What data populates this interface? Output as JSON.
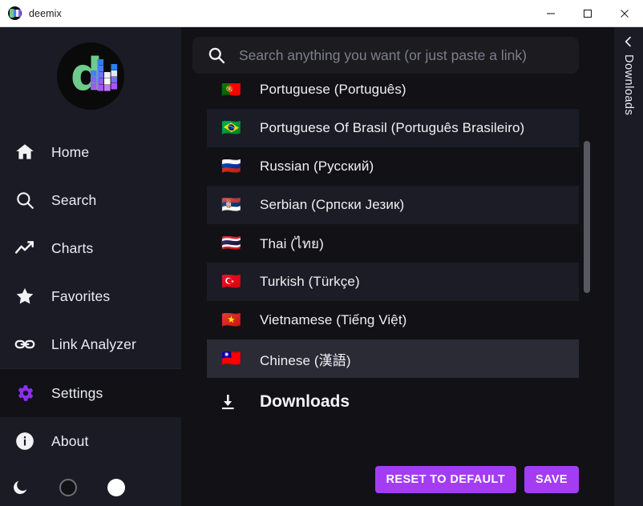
{
  "window": {
    "title": "deemix",
    "logo_icon": "deemix-logo-icon",
    "controls": {
      "minimize": "minimize-icon",
      "maximize": "maximize-icon",
      "close": "close-icon"
    }
  },
  "sidebar": {
    "logo_icon": "deemix-logo-icon",
    "items": [
      {
        "label": "Home",
        "icon": "home-icon",
        "active": false
      },
      {
        "label": "Search",
        "icon": "search-icon",
        "active": false
      },
      {
        "label": "Charts",
        "icon": "chart-line-icon",
        "active": false
      },
      {
        "label": "Favorites",
        "icon": "star-icon",
        "active": false
      },
      {
        "label": "Link Analyzer",
        "icon": "link-icon",
        "active": false
      },
      {
        "label": "Settings",
        "icon": "gear-icon",
        "active": true
      },
      {
        "label": "About",
        "icon": "info-circle-icon",
        "active": false
      }
    ],
    "themes": [
      {
        "name": "dark-theme-toggle",
        "icon": "moon-icon"
      },
      {
        "name": "black-theme-toggle",
        "icon": "dark-circle-icon"
      },
      {
        "name": "light-theme-toggle",
        "icon": "light-circle-icon"
      }
    ]
  },
  "search": {
    "placeholder": "Search anything you want (or just paste a link)",
    "value": "",
    "icon": "search-icon"
  },
  "languages": [
    {
      "name": "Portuguese (Português)",
      "flag": "🇵🇹",
      "selected": false
    },
    {
      "name": "Portuguese Of Brasil (Português Brasileiro)",
      "flag": "🇧🇷",
      "selected": false
    },
    {
      "name": "Russian (Русский)",
      "flag": "🇷🇺",
      "selected": false
    },
    {
      "name": "Serbian (Српски Језик)",
      "flag": "🇷🇸",
      "selected": false
    },
    {
      "name": "Thai (ไทย)",
      "flag": "🇹🇭",
      "selected": false
    },
    {
      "name": "Turkish (Türkçe)",
      "flag": "🇹🇷",
      "selected": false
    },
    {
      "name": "Vietnamese (Tiếng Việt)",
      "flag": "🇻🇳",
      "selected": false
    },
    {
      "name": "Chinese (漢語)",
      "flag": "🇹🇼",
      "selected": true
    }
  ],
  "downloads_section": {
    "title": "Downloads",
    "icon": "download-icon"
  },
  "footer": {
    "reset_label": "RESET TO DEFAULT",
    "save_label": "SAVE"
  },
  "downloads_panel": {
    "label": "Downloads",
    "chevron_icon": "chevron-left-icon"
  },
  "colors": {
    "accent": "#a43cf4",
    "active_icon": "#8c2ef0",
    "sidebar_bg": "#1a1b24",
    "content_bg": "#111116",
    "row_alt_bg": "#1b1c25",
    "row_selected_bg": "#2a2b35",
    "logo_green": "#6ecb8b"
  }
}
